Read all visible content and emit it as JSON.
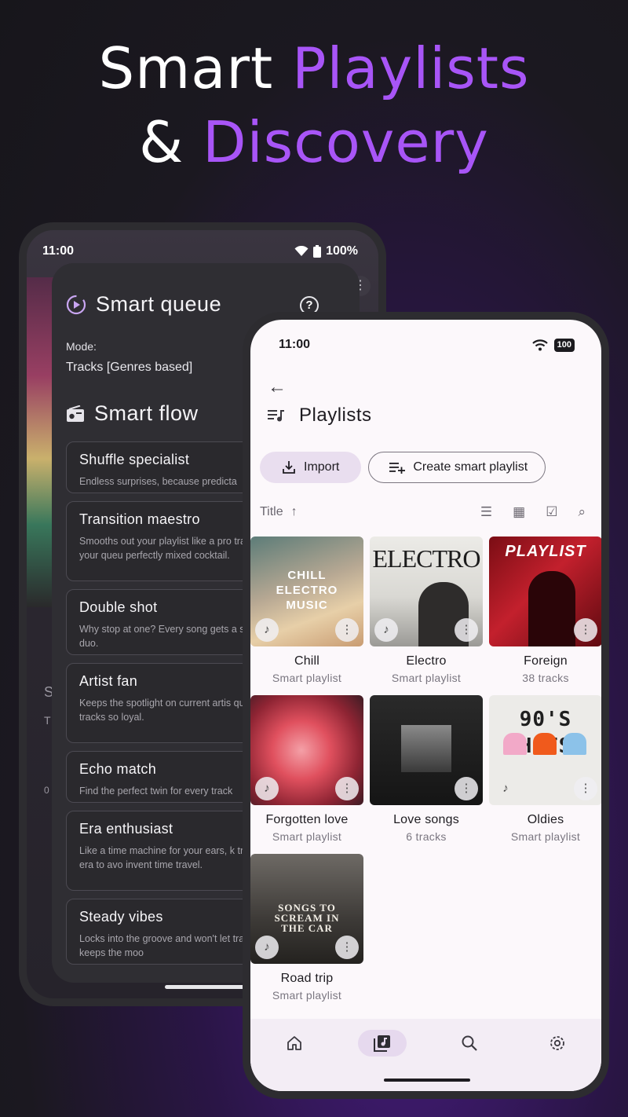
{
  "headline": {
    "line1_a": "Smart",
    "line1_b": "Playlists",
    "line2_a": "&",
    "line2_b": "Discovery"
  },
  "colors": {
    "accent": "#a855f7",
    "surface_dark": "#2f2e33",
    "surface_light": "#fcf8fb",
    "nav_active": "#e6d9ee"
  },
  "back_phone": {
    "time": "11:00",
    "battery": "100%",
    "side_letters": [
      "S",
      "T",
      "0"
    ],
    "smart_queue": {
      "title": "Smart queue",
      "mode_label": "Mode:",
      "mode_value": "Tracks [Genres based]"
    },
    "smart_flow": {
      "title": "Smart flow",
      "items": [
        {
          "name": "Shuffle specialist",
          "desc": "Endless surprises, because predicta"
        },
        {
          "name": "Transition maestro",
          "desc": "Smooths out your playlist like a pro tracks between songs so your queu perfectly mixed cocktail."
        },
        {
          "name": "Double shot",
          "desc": "Why stop at one? Every song gets a sidekick for the ultimate duo."
        },
        {
          "name": "Artist fan",
          "desc": "Keeps the spotlight on current artis queue with more of their tracks so loyal."
        },
        {
          "name": "Echo match",
          "desc": "Find the perfect twin for every track"
        },
        {
          "name": "Era enthusiast",
          "desc": "Like a time machine for your ears, k track locked in the same era to avo invent time travel."
        },
        {
          "name": "Steady vibes",
          "desc": "Locks into the groove and won't let track after track that keeps the moo"
        }
      ]
    }
  },
  "front_phone": {
    "time": "11:00",
    "battery": "100",
    "page_title": "Playlists",
    "import_label": "Import",
    "create_label": "Create smart playlist",
    "sort_label": "Title",
    "playlists": [
      {
        "name": "Chill",
        "sub": "Smart playlist",
        "cover_text": "CHILL\nELECTRO\nMUSIC"
      },
      {
        "name": "Electro",
        "sub": "Smart playlist",
        "cover_text": "ELECTRO"
      },
      {
        "name": "Foreign",
        "sub": "38 tracks",
        "cover_text": "PLAYLIST"
      },
      {
        "name": "Forgotten love",
        "sub": "Smart playlist",
        "cover_text": ""
      },
      {
        "name": "Love songs",
        "sub": "6 tracks",
        "cover_text": ""
      },
      {
        "name": "Oldies",
        "sub": "Smart playlist",
        "cover_text": "90'S\nHITS"
      },
      {
        "name": "Road trip",
        "sub": "Smart playlist",
        "cover_text": "SONGS TO\nSCREAM IN\nTHE CAR"
      }
    ],
    "nav": [
      {
        "icon": "home-icon"
      },
      {
        "icon": "library-icon",
        "active": true
      },
      {
        "icon": "search-icon"
      },
      {
        "icon": "settings-icon"
      }
    ]
  }
}
